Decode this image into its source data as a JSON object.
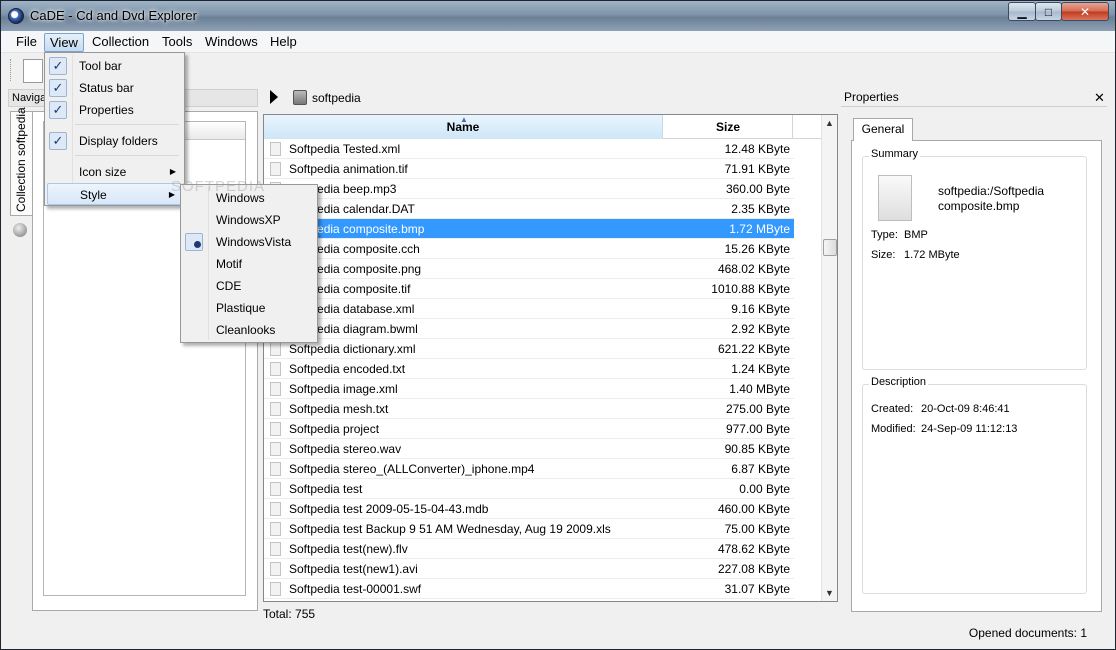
{
  "window": {
    "title": "CaDE - Cd and Dvd Explorer",
    "watermark": "SOFTPEDIA"
  },
  "menubar": [
    "File",
    "View",
    "Collection",
    "Tools",
    "Windows",
    "Help"
  ],
  "view_menu": {
    "items": [
      {
        "label": "Tool bar",
        "checked": true
      },
      {
        "label": "Status bar",
        "checked": true
      },
      {
        "label": "Properties",
        "checked": true
      },
      {
        "label": "Display folders",
        "checked": true
      },
      {
        "label": "Icon size",
        "submenu": true
      },
      {
        "label": "Style",
        "submenu": true,
        "highlighted": true
      }
    ]
  },
  "style_menu": {
    "items": [
      "Windows",
      "WindowsXP",
      "WindowsVista",
      "Motif",
      "CDE",
      "Plastique",
      "Cleanlooks"
    ],
    "selected": "WindowsVista"
  },
  "watermark_small": "SOFTPEDIA",
  "navigation": {
    "header": "Navigation",
    "tab_label": "Collection softpedia"
  },
  "path": {
    "label": "softpedia"
  },
  "table": {
    "headers": {
      "name": "Name",
      "size": "Size"
    },
    "selected_index": 4,
    "rows": [
      {
        "name": "Softpedia Tested.xml",
        "size": "12.48 KByte"
      },
      {
        "name": "Softpedia animation.tif",
        "size": "71.91 KByte"
      },
      {
        "name": "Softpedia beep.mp3",
        "size": "360.00 Byte"
      },
      {
        "name": "Softpedia calendar.DAT",
        "size": "2.35 KByte"
      },
      {
        "name": "Softpedia composite.bmp",
        "size": "1.72 MByte"
      },
      {
        "name": "Softpedia composite.cch",
        "size": "15.26 KByte"
      },
      {
        "name": "Softpedia composite.png",
        "size": "468.02 KByte"
      },
      {
        "name": "Softpedia composite.tif",
        "size": "1010.88 KByte"
      },
      {
        "name": "Softpedia database.xml",
        "size": "9.16 KByte"
      },
      {
        "name": "Softpedia diagram.bwml",
        "size": "2.92 KByte"
      },
      {
        "name": "Softpedia dictionary.xml",
        "size": "621.22 KByte"
      },
      {
        "name": "Softpedia encoded.txt",
        "size": "1.24 KByte"
      },
      {
        "name": "Softpedia image.xml",
        "size": "1.40 MByte"
      },
      {
        "name": "Softpedia mesh.txt",
        "size": "275.00 Byte"
      },
      {
        "name": "Softpedia project",
        "size": "977.00 Byte"
      },
      {
        "name": "Softpedia stereo.wav",
        "size": "90.85 KByte"
      },
      {
        "name": "Softpedia stereo_(ALLConverter)_iphone.mp4",
        "size": "6.87 KByte"
      },
      {
        "name": "Softpedia test",
        "size": "0.00 Byte"
      },
      {
        "name": "Softpedia test 2009-05-15-04-43.mdb",
        "size": "460.00 KByte"
      },
      {
        "name": "Softpedia test Backup 9 51 AM Wednesday, Aug 19 2009.xls",
        "size": "75.00 KByte"
      },
      {
        "name": "Softpedia test(new).flv",
        "size": "478.62 KByte"
      },
      {
        "name": "Softpedia test(new1).avi",
        "size": "227.08 KByte"
      },
      {
        "name": "Softpedia test-00001.swf",
        "size": "31.07 KByte"
      }
    ],
    "total": "Total: 755"
  },
  "properties": {
    "header": "Properties",
    "tab": "General",
    "summary_title": "Summary",
    "path_line1": "softpedia:/Softpedia",
    "path_line2": "composite.bmp",
    "type_label": "Type:",
    "type_value": "BMP",
    "size_label": "Size:",
    "size_value": "1.72 MByte",
    "description_title": "Description",
    "created_label": "Created:",
    "created_value": "20-Oct-09 8:46:41",
    "modified_label": "Modified:",
    "modified_value": "24-Sep-09 11:12:13"
  },
  "statusbar": {
    "message": "Opened documents: 1"
  }
}
